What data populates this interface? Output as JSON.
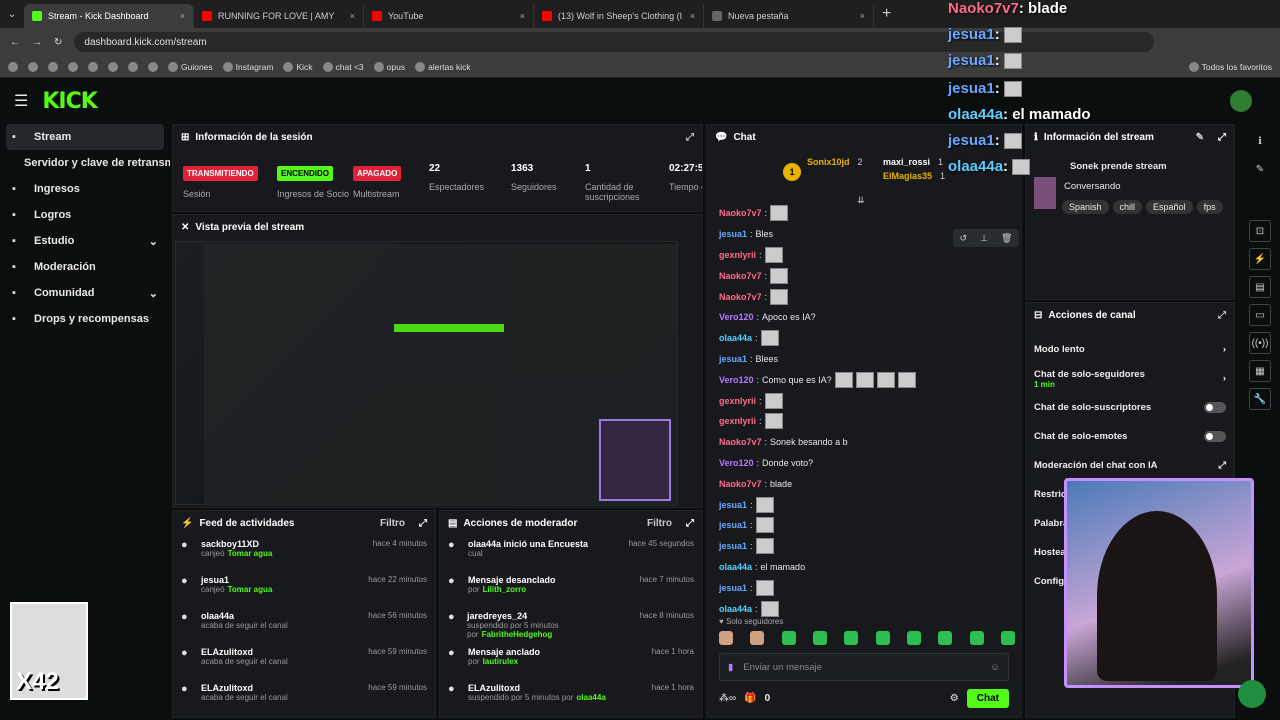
{
  "browser": {
    "tabs": [
      {
        "title": "Stream - Kick Dashboard",
        "color": "#53fc18"
      },
      {
        "title": "RUNNING FOR LOVE | AMY",
        "color": "#ff0000"
      },
      {
        "title": "YouTube",
        "color": "#ff0000"
      },
      {
        "title": "(13) Wolf in Sheep's Clothing (I",
        "color": "#ff0000"
      },
      {
        "title": "Nueva pestaña",
        "color": "#666"
      }
    ],
    "url": "dashboard.kick.com/stream",
    "bookmarks": [
      "Guiones",
      "Instagram",
      "Kick",
      "chat <3",
      "opus",
      "alertas kick",
      "Todos los favoritos"
    ]
  },
  "sidebar": {
    "items": [
      {
        "label": "Stream",
        "icon": "broadcast-icon",
        "active": true
      },
      {
        "label": "Servidor y clave de retransmisión",
        "icon": "",
        "sub": true
      },
      {
        "label": "Ingresos",
        "icon": "income-icon"
      },
      {
        "label": "Logros",
        "icon": "trophy-icon"
      },
      {
        "label": "Estudio",
        "icon": "studio-icon",
        "chevron": true
      },
      {
        "label": "Moderación",
        "icon": "wrench-icon"
      },
      {
        "label": "Comunidad",
        "icon": "community-icon",
        "chevron": true
      },
      {
        "label": "Drops y recompensas",
        "icon": "gift-icon"
      }
    ]
  },
  "session": {
    "title": "Información de la sesión",
    "badges": [
      {
        "text": "TRANSMITIENDO",
        "label": "Sesión",
        "bg": "#e0213a",
        "fg": "#fff"
      },
      {
        "text": "ENCENDIDO",
        "label": "Ingresos de Socio",
        "bg": "#53fc18",
        "fg": "#000"
      },
      {
        "text": "APAGADO",
        "label": "Multistream",
        "bg": "#e0213a",
        "fg": "#fff"
      }
    ],
    "stats": [
      {
        "value": "22",
        "label": "Espectadores"
      },
      {
        "value": "1363",
        "label": "Seguidores"
      },
      {
        "value": "1",
        "label": "Cantidad de suscripciones"
      },
      {
        "value": "02:27:5",
        "label": "Tiempo en vivo"
      }
    ]
  },
  "preview": {
    "title": "Vista previa del stream"
  },
  "feed": {
    "title": "Feed de actividades",
    "filter": "Filtro",
    "items": [
      {
        "name": "sackboy11XD",
        "sub": "canjeó",
        "reward": "Tomar agua",
        "time": "hace 4 minutos",
        "icon": "points-icon"
      },
      {
        "name": "jesua1",
        "sub": "canjeó",
        "reward": "Tomar agua",
        "time": "hace 22 minutos",
        "icon": "points-icon"
      },
      {
        "name": "olaa44a",
        "sub": "acaba de seguir el canal",
        "reward": "",
        "time": "hace 56 minutos",
        "icon": "heart-icon"
      },
      {
        "name": "ELAzulitoxd",
        "sub": "acaba de seguir el canal",
        "reward": "",
        "time": "hace 59 minutos",
        "icon": "heart-icon"
      },
      {
        "name": "ELAzulitoxd",
        "sub": "acaba de seguir el canal",
        "reward": "",
        "time": "hace 59 minutos",
        "icon": "heart-icon"
      }
    ]
  },
  "modactions": {
    "title": "Acciones de moderador",
    "filter": "Filtro",
    "items": [
      {
        "name": "olaa44a inició una Encuesta",
        "sub": "cual",
        "by": "",
        "time": "hace 45 segundos",
        "icon": "poll-icon"
      },
      {
        "name": "Mensaje desanclado",
        "sub": "por",
        "by": "Lilith_zorro",
        "time": "hace 7 minutos",
        "icon": "unpin-icon"
      },
      {
        "name": "jaredreyes_24",
        "sub": "suspendido por 5 minutos por",
        "by": "FabritheHedgehog",
        "time": "hace 8 minutos",
        "icon": "hourglass-icon"
      },
      {
        "name": "Mensaje anclado",
        "sub": "por",
        "by": "lautirulex",
        "time": "hace 1 hora",
        "icon": "pin-icon"
      },
      {
        "name": "ELAzulitoxd",
        "sub": "suspendido por 5 minutos por",
        "by": "olaa44a",
        "time": "hace 1 hora",
        "icon": "hourglass-icon"
      }
    ]
  },
  "chat": {
    "title": "Chat",
    "top": [
      {
        "name": "Sonix10jd",
        "count": "2"
      },
      {
        "name": "maxi_rossi",
        "count": "1"
      },
      {
        "name": "ElMagias35",
        "count": "1"
      }
    ],
    "messages": [
      {
        "user": "Naoko7v7",
        "cls": "u-pink",
        "text": "",
        "emotes": 1
      },
      {
        "user": "jesua1",
        "cls": "u-blue",
        "text": "Bles",
        "emotes": 0
      },
      {
        "user": "gexnlyrii",
        "cls": "u-pink",
        "text": "",
        "emotes": 1
      },
      {
        "user": "Naoko7v7",
        "cls": "u-pink",
        "text": "",
        "emotes": 1
      },
      {
        "user": "Naoko7v7",
        "cls": "u-pink",
        "text": "",
        "emotes": 1
      },
      {
        "user": "Vero120",
        "cls": "u-purple",
        "text": "Apoco es IA?",
        "emotes": 0
      },
      {
        "user": "olaa44a",
        "cls": "u-cyan",
        "text": "",
        "emotes": 1
      },
      {
        "user": "jesua1",
        "cls": "u-blue",
        "text": "Blees",
        "emotes": 0
      },
      {
        "user": "Vero120",
        "cls": "u-purple",
        "text": "Como que es IA?",
        "emotes": 4
      },
      {
        "user": "gexnlyrii",
        "cls": "u-pink",
        "text": "",
        "emotes": 1
      },
      {
        "user": "gexnlyrii",
        "cls": "u-pink",
        "text": "",
        "emotes": 1
      },
      {
        "user": "Naoko7v7",
        "cls": "u-pink",
        "text": "Sonek besando a b",
        "emotes": 0
      },
      {
        "user": "Vero120",
        "cls": "u-purple",
        "text": "Donde voto?",
        "emotes": 0
      },
      {
        "user": "Naoko7v7",
        "cls": "u-pink",
        "text": "blade",
        "emotes": 0
      },
      {
        "user": "jesua1",
        "cls": "u-blue",
        "text": "",
        "emotes": 1
      },
      {
        "user": "jesua1",
        "cls": "u-blue",
        "text": "",
        "emotes": 1
      },
      {
        "user": "jesua1",
        "cls": "u-blue",
        "text": "",
        "emotes": 1
      },
      {
        "user": "olaa44a",
        "cls": "u-cyan",
        "text": "el mamado",
        "emotes": 0
      },
      {
        "user": "jesua1",
        "cls": "u-blue",
        "text": "",
        "emotes": 1
      },
      {
        "user": "olaa44a",
        "cls": "u-cyan",
        "text": "",
        "emotes": 1
      }
    ],
    "mode": "Solo seguidores",
    "placeholder": "Enviar un mensaje",
    "points": "0",
    "send": "Chat"
  },
  "streaminfo": {
    "title": "Información del stream",
    "stream_title": "Sonek prende stream",
    "category": "Conversando",
    "tags": [
      "Spanish",
      "chill",
      "Español",
      "fps"
    ]
  },
  "actions": {
    "title": "Acciones de canal",
    "rows": [
      {
        "label": "Modo lento",
        "sub": "",
        "ctrl": "chevron"
      },
      {
        "label": "Chat de solo-seguidores",
        "sub": "1 min",
        "ctrl": "chevron"
      },
      {
        "label": "Chat de solo-suscriptores",
        "sub": "",
        "ctrl": "toggle"
      },
      {
        "label": "Chat de solo-emotes",
        "sub": "",
        "ctrl": "toggle"
      },
      {
        "label": "Moderación del chat con IA",
        "sub": "",
        "ctrl": "ext"
      },
      {
        "label": "Restric",
        "sub": "",
        "ctrl": ""
      },
      {
        "label": "Palabra",
        "sub": "",
        "ctrl": ""
      },
      {
        "label": "Hostea",
        "sub": "",
        "ctrl": ""
      },
      {
        "label": "Config",
        "sub": "",
        "ctrl": ""
      }
    ]
  },
  "overlay": [
    {
      "user": "Naoko7v7",
      "text": ": blade",
      "color": "#ff6b8b"
    },
    {
      "user": "jesua1",
      "text": ":",
      "color": "#69a8ff"
    },
    {
      "user": "jesua1",
      "text": ":",
      "color": "#69a8ff"
    },
    {
      "user": "jesua1",
      "text": ":",
      "color": "#69a8ff"
    },
    {
      "user": "olaa44a",
      "text": ": el mamado",
      "color": "#5ad0ff"
    },
    {
      "user": "jesua1",
      "text": ":",
      "color": "#69a8ff"
    },
    {
      "user": "olaa44a",
      "text": ":",
      "color": "#5ad0ff"
    }
  ],
  "watermark": "X42"
}
